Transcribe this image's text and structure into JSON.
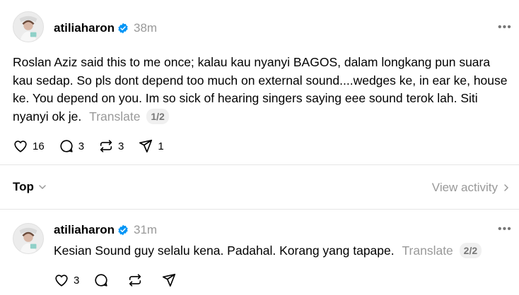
{
  "post": {
    "username": "atiliaharon",
    "timestamp": "38m",
    "more_label": "•••",
    "text": "Roslan Aziz said this to me once; kalau kau nyanyi BAGOS, dalam longkang pun suara kau sedap. So pls dont depend too much on external sound....wedges ke, in ear ke, house ke. You depend on you. Im so sick of hearing singers saying eee sound terok lah. Siti nyanyi ok je.",
    "translate_label": "Translate",
    "page_label": "1/2",
    "likes": "16",
    "replies": "3",
    "reposts": "3",
    "shares": "1",
    "icons": [
      "heart-icon",
      "comment-icon",
      "repost-icon",
      "share-icon"
    ]
  },
  "sort": {
    "label": "Top",
    "view_activity": "View activity"
  },
  "reply": {
    "username": "atiliaharon",
    "timestamp": "31m",
    "more_label": "•••",
    "text": "Kesian Sound guy selalu kena. Padahal. Korang yang tapape.",
    "translate_label": "Translate",
    "page_label": "2/2",
    "likes": "3"
  },
  "colors": {
    "verified": "#0095f6",
    "muted": "#999999",
    "divider": "#e6e6e6"
  }
}
